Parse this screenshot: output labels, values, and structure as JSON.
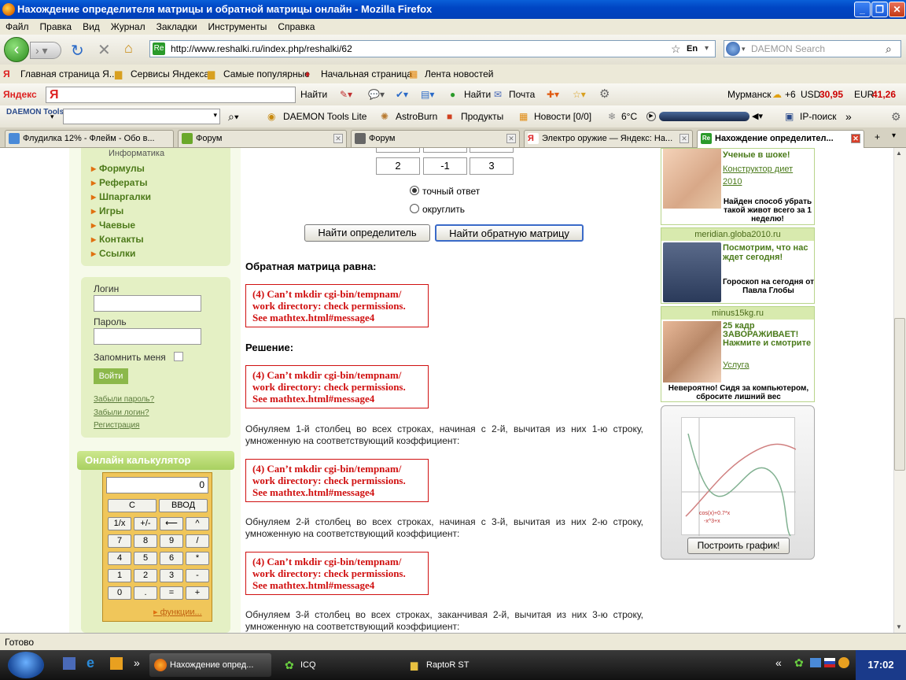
{
  "window": {
    "title": "Нахождение определителя матрицы и обратной матрицы онлайн - Mozilla Firefox"
  },
  "menu": [
    "Файл",
    "Правка",
    "Вид",
    "Журнал",
    "Закладки",
    "Инструменты",
    "Справка"
  ],
  "nav": {
    "url": "http://www.reshalki.ru/index.php/reshalki/62",
    "lang": "En",
    "search_placeholder": "DAEMON Search",
    "site_icon": "Re"
  },
  "bookmarks": [
    "Главная страница Я...",
    "Сервисы Яндекса",
    "Самые популярные",
    "Начальная страница",
    "Лента новостей"
  ],
  "yandex": {
    "logo": "Яндекс",
    "find": "Найти",
    "find2": "Найти",
    "mail": "Почта",
    "city": "Мурманск",
    "temp": "+6",
    "usd_label": "USD",
    "usd": "30,95",
    "eur_label": "EUR",
    "eur": "41,26"
  },
  "daemon": {
    "logo": "DAEMON Tools",
    "lite": "DAEMON Tools Lite",
    "astro": "AstroBurn",
    "products": "Продукты",
    "news": "Новости [0/0]",
    "temp": "6°C",
    "ip": "IP-поиск"
  },
  "tabs": [
    "Флудилка 12% - Флейм - Обо в...",
    "Форум",
    "Форум",
    "Электро оружие — Яндекс: На...",
    "Нахождение определител..."
  ],
  "left": {
    "top_item": "Информатика",
    "menu": [
      "Формулы",
      "Рефераты",
      "Шпаргалки",
      "Игры",
      "Чаевые",
      "Контакты",
      "Ссылки"
    ],
    "login_label": "Логин",
    "password_label": "Пароль",
    "remember": "Запомнить меня",
    "login_button": "Войти",
    "links": [
      "Забыли пароль?",
      "Забыли логин?",
      "Регистрация"
    ],
    "calc_header": "Онлайн калькулятор",
    "calc_display": "0",
    "calc_keys": [
      [
        "С",
        "ВВОД"
      ],
      [
        "1/x",
        "+/-",
        "⟵",
        "^"
      ],
      [
        "7",
        "8",
        "9",
        "/"
      ],
      [
        "4",
        "5",
        "6",
        "*"
      ],
      [
        "1",
        "2",
        "3",
        "-"
      ],
      [
        "0",
        ".",
        "=",
        "+"
      ]
    ],
    "calc_functions": "функции..."
  },
  "center": {
    "matrix_row": [
      "2",
      "-1",
      "3"
    ],
    "radio_exact": "точный ответ",
    "radio_round": "округлить",
    "btn_det": "Найти определитель",
    "btn_inv": "Найти обратную матрицу",
    "inverse_heading": "Обратная матрица равна:",
    "solution_heading": "Решение:",
    "error_text": "(4) Can’t mkdir cgi-bin/tempnam/ work directory: check permissions. See mathtex.html#message4",
    "step1": "Обнуляем 1-й столбец во всех строках, начиная с 2-й, вычитая из них 1-ю строку, умноженную на соответствующий коэффициент:",
    "step2": "Обнуляем 2-й столбец во всех строках, начиная с 3-й, вычитая из них 2-ю строку, умноженную на соответствующий коэффициент:",
    "step3": "Обнуляем 3-й столбец во всех строках, заканчивая 2-й, вычитая из них 3-ю строку, умноженную на соответствующий коэффициент:"
  },
  "ads": [
    {
      "head": "",
      "title": "Ученые в шоке!",
      "link": "Конструктор диет 2010",
      "bottom": "Найден способ убрать такой живот всего за 1 неделю!"
    },
    {
      "head": "meridian.globa2010.ru",
      "title": "Посмотрим, что нас ждет сегодня!",
      "link": "",
      "bottom": "Гороскоп на сегодня от Павла Глобы"
    },
    {
      "head": "minus15kg.ru",
      "title": "25 кадр ЗАВОРАЖИВАЕТ! Нажмите и смотрите",
      "link": "Услуга",
      "bottom": "Невероятно! Сидя за компьютером, сбросите лишний вес"
    }
  ],
  "graph": {
    "legend1": "cos(x)+0.7*x",
    "legend2": "-x^3+x",
    "button": "Построить график!"
  },
  "status": "Готово",
  "taskbar": {
    "items": [
      "Нахождение опред...",
      "ICQ",
      "RaptoR ST"
    ],
    "time": "17:02"
  }
}
